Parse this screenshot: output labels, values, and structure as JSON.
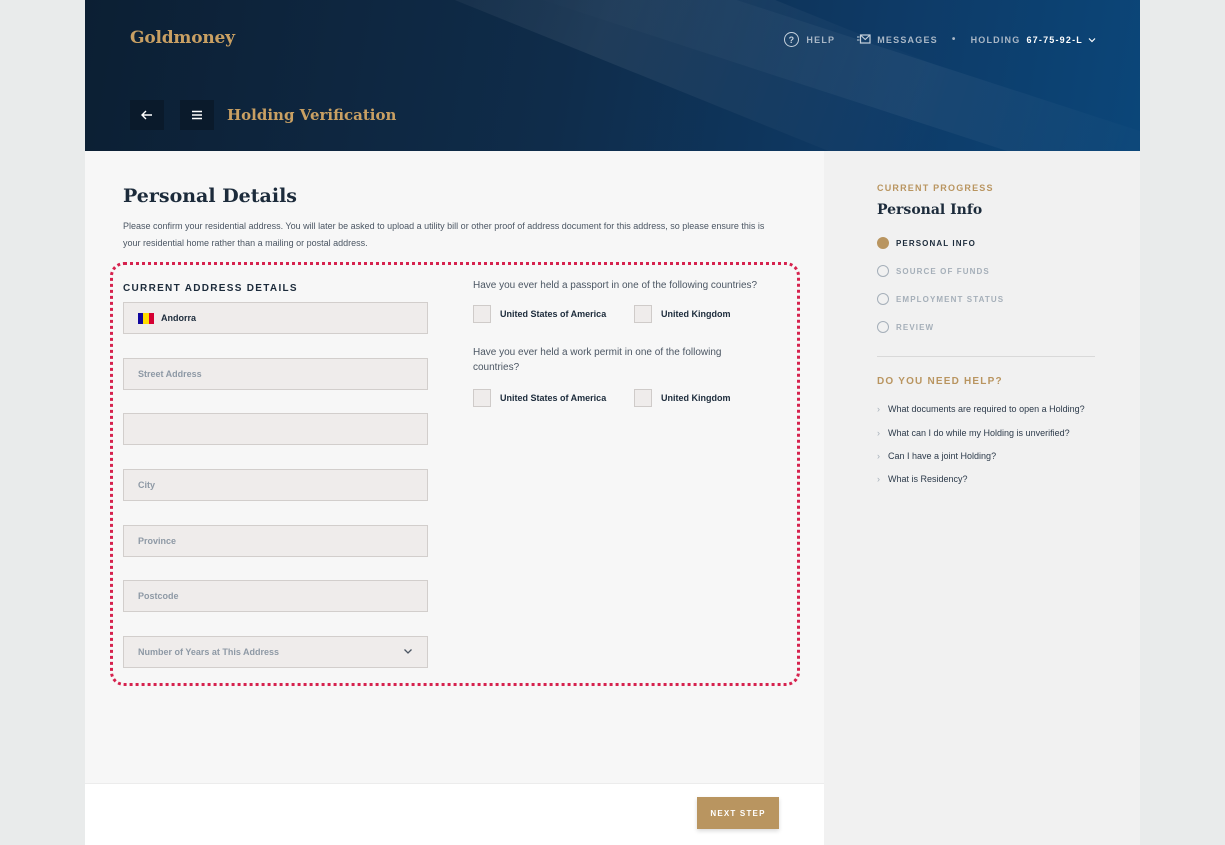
{
  "brand": {
    "logo_text": "Goldmoney",
    "gold": "#c9a063",
    "navy": "#0c1f33",
    "accent": "#d6224e"
  },
  "topnav": {
    "help_label": "HELP",
    "messages_label": "MESSAGES",
    "separator": "•",
    "holding_label": "HOLDING",
    "holding_number": "67-75-92-L"
  },
  "header": {
    "title": "Holding Verification",
    "back_icon": "arrow-left-icon",
    "menu_icon": "hamburger-icon"
  },
  "main": {
    "title": "Personal Details",
    "description": "Please confirm your residential address. You will later be asked to upload a utility bill or other proof of address document for this address, so please ensure this is your residential home rather than a mailing or postal address.",
    "section_label": "CURRENT ADDRESS DETAILS",
    "fields": {
      "country_value": "Andorra",
      "street_placeholder": "Street Address",
      "street2_placeholder": "",
      "city_placeholder": "City",
      "province_placeholder": "Province",
      "postcode_placeholder": "Postcode",
      "years_placeholder": "Number of Years at This Address"
    },
    "passport_question": "Have you ever held a passport in one of the following countries?",
    "work_permit_question": "Have you ever held a work permit in one of the following countries?",
    "options": {
      "usa": "United States of America",
      "uk": "United Kingdom"
    },
    "next_button": "NEXT STEP"
  },
  "sidebar": {
    "progress_label": "CURRENT PROGRESS",
    "progress_title": "Personal Info",
    "steps": [
      {
        "label": "PERSONAL INFO",
        "active": true
      },
      {
        "label": "SOURCE OF FUNDS",
        "active": false
      },
      {
        "label": "EMPLOYMENT STATUS",
        "active": false
      },
      {
        "label": "REVIEW",
        "active": false
      }
    ],
    "help_heading": "DO YOU NEED HELP?",
    "help_links": [
      "What documents are required to open a Holding?",
      "What can I do while my Holding is unverified?",
      "Can I have a joint Holding?",
      "What is Residency?"
    ]
  }
}
